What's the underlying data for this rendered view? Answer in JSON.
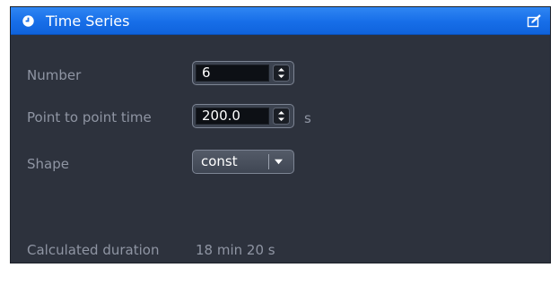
{
  "panel": {
    "title": "Time Series",
    "title_icon": "clock-icon",
    "edit_icon": "edit-icon"
  },
  "fields": {
    "number": {
      "label": "Number",
      "value": "6"
    },
    "point_to_point_time": {
      "label": "Point to point time",
      "value": "200.0",
      "unit": "s"
    },
    "shape": {
      "label": "Shape",
      "selected": "const"
    }
  },
  "calculated_duration": {
    "label": "Calculated duration",
    "value": "18 min 20 s"
  },
  "colors": {
    "titlebar": "#176ee8",
    "panel_bg": "#2d323d",
    "label": "#8f95a3",
    "field_bg": "#0d1015"
  }
}
